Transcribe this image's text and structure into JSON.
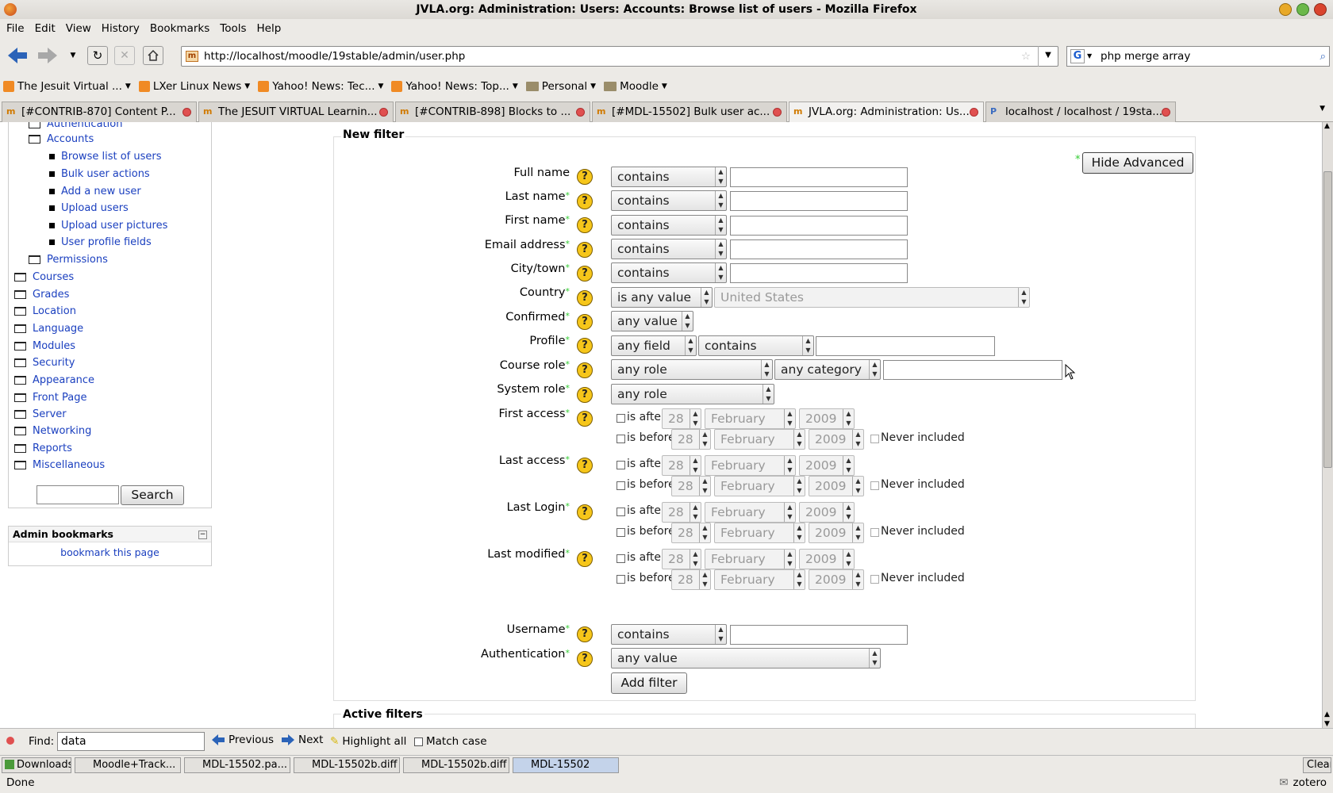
{
  "window": {
    "title": "JVLA.org: Administration: Users: Accounts: Browse list of users - Mozilla Firefox"
  },
  "menu": [
    "File",
    "Edit",
    "View",
    "History",
    "Bookmarks",
    "Tools",
    "Help"
  ],
  "nav": {
    "url": "http://localhost/moodle/19stable/admin/user.php",
    "search": "php merge array",
    "url_favicon": "m"
  },
  "bookmarks": [
    {
      "label": "The Jesuit Virtual ...",
      "icon": "rss-icon"
    },
    {
      "label": "LXer Linux News",
      "icon": "rss-icon"
    },
    {
      "label": "Yahoo! News: Tec...",
      "icon": "rss-icon"
    },
    {
      "label": "Yahoo! News: Top...",
      "icon": "rss-icon"
    },
    {
      "label": "Personal",
      "icon": "folder-icon"
    },
    {
      "label": "Moodle",
      "icon": "folder-icon"
    }
  ],
  "tabs": [
    {
      "label": "[#CONTRIB-870] Content P..."
    },
    {
      "label": "The JESUIT VIRTUAL Learnin..."
    },
    {
      "label": "[#CONTRIB-898] Blocks to ..."
    },
    {
      "label": "[#MDL-15502] Bulk user ac..."
    },
    {
      "label": "JVLA.org: Administration: Us..."
    },
    {
      "label": "localhost / localhost / 19sta..."
    }
  ],
  "sidebar": {
    "authentication": "Authentication",
    "accounts": "Accounts",
    "account_items": [
      "Browse list of users",
      "Bulk user actions",
      "Add a new user",
      "Upload users",
      "Upload user pictures",
      "User profile fields"
    ],
    "permissions": "Permissions",
    "folders": [
      "Courses",
      "Grades",
      "Location",
      "Language",
      "Modules",
      "Security",
      "Appearance",
      "Front Page",
      "Server",
      "Networking",
      "Reports",
      "Miscellaneous"
    ],
    "search_button": "Search",
    "bookmarks_title": "Admin bookmarks",
    "bookmark_link": "bookmark this page"
  },
  "filter": {
    "legend": "New filter",
    "hide_advanced": "Hide Advanced",
    "asterisk": "*",
    "help_glyph": "?",
    "labels": {
      "fullname": "Full name",
      "lastname": "Last name",
      "firstname": "First name",
      "email": "Email address",
      "city": "City/town",
      "country": "Country",
      "confirmed": "Confirmed",
      "profile": "Profile",
      "courserole": "Course role",
      "systemrole": "System role",
      "firstaccess": "First access",
      "lastaccess": "Last access",
      "lastlogin": "Last Login",
      "lastmodified": "Last modified",
      "username": "Username",
      "auth": "Authentication"
    },
    "contains": "contains",
    "is_any_value": "is any value",
    "country_value": "United States",
    "any_value": "any value",
    "any_field": "any field",
    "any_role": "any role",
    "any_category": "any category",
    "is_after": "is after",
    "is_before": "is before",
    "day": "28",
    "month": "February",
    "year": "2009",
    "never_included": "Never included",
    "add_filter": "Add filter",
    "active_filters": "Active filters"
  },
  "findbar": {
    "label": "Find:",
    "value": "data",
    "previous": "Previous",
    "next": "Next",
    "highlight": "Highlight all",
    "match_case": "Match case"
  },
  "downloads": {
    "label": "Downloads",
    "items": [
      "Moodle+Track...",
      "MDL-15502.pa...",
      "MDL-15502b.diff",
      "MDL-15502b.diff",
      "MDL-15502"
    ],
    "clear": "Clear"
  },
  "status": {
    "text": "Done",
    "addon": "zotero"
  }
}
